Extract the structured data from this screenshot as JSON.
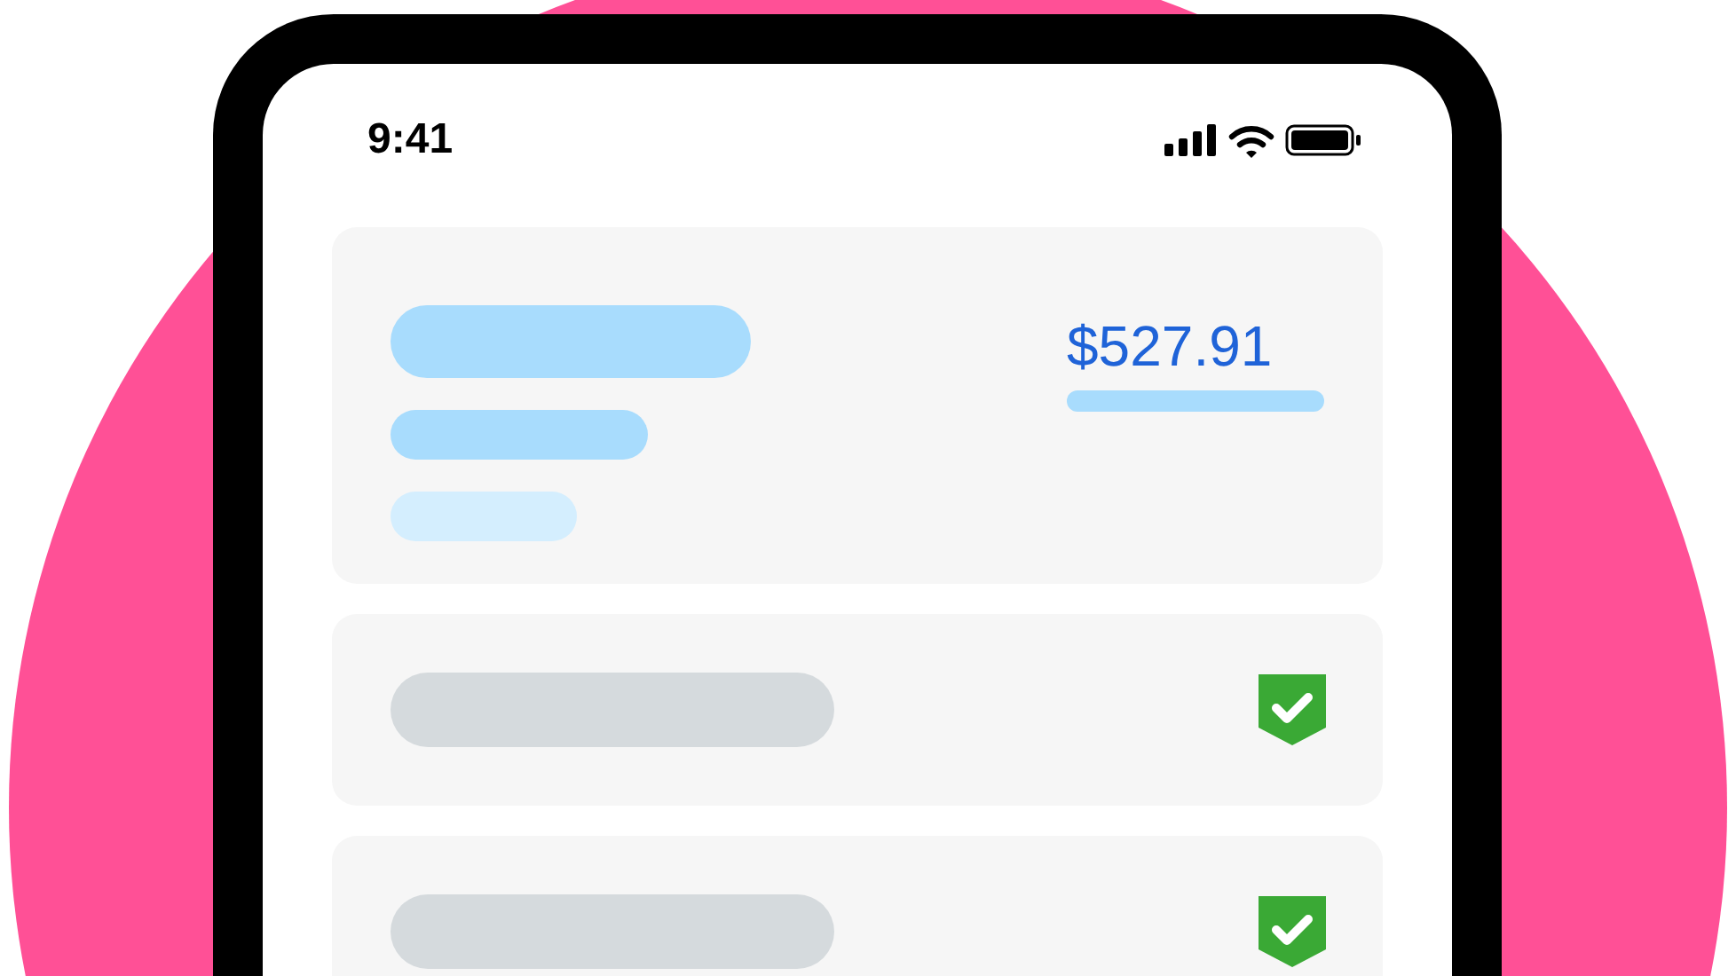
{
  "status_bar": {
    "time": "9:41"
  },
  "summary": {
    "amount": "$527.91"
  },
  "items": [
    {
      "verified": true
    },
    {
      "verified": true
    }
  ]
}
